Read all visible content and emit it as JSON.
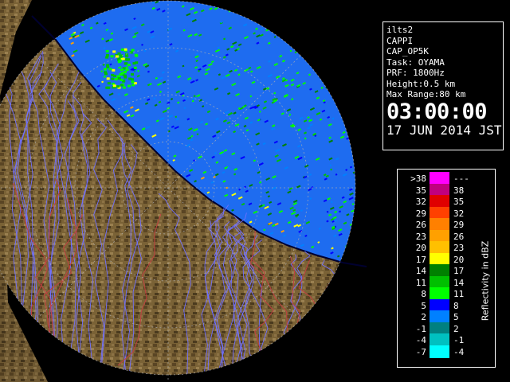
{
  "info": {
    "station": "ilts2",
    "product": "CAPPI",
    "product_code": "CAP_OP5K",
    "task": "Task: OYAMA",
    "prf": "PRF: 1800Hz",
    "height": "Height:0.5 km",
    "max_range": "Max Range:80 km",
    "time": "03:00:00",
    "date": "17 JUN 2014 JST"
  },
  "legend": {
    "unit_label": "Reflectivity in dBZ",
    "bins": [
      {
        "min": ">38",
        "max": "---",
        "color": "#ff00ff"
      },
      {
        "min": "35",
        "max": "38",
        "color": "#c00080"
      },
      {
        "min": "32",
        "max": "35",
        "color": "#e00000"
      },
      {
        "min": "29",
        "max": "32",
        "color": "#ff4000"
      },
      {
        "min": "26",
        "max": "29",
        "color": "#ff8000"
      },
      {
        "min": "23",
        "max": "26",
        "color": "#ffa000"
      },
      {
        "min": "20",
        "max": "23",
        "color": "#ffc000"
      },
      {
        "min": "17",
        "max": "20",
        "color": "#ffff00"
      },
      {
        "min": "14",
        "max": "17",
        "color": "#008000"
      },
      {
        "min": "11",
        "max": "14",
        "color": "#00c000"
      },
      {
        "min": "8",
        "max": "11",
        "color": "#00ff00"
      },
      {
        "min": "5",
        "max": "8",
        "color": "#0000ff"
      },
      {
        "min": "2",
        "max": "5",
        "color": "#0080ff"
      },
      {
        "min": "-1",
        "max": "2",
        "color": "#008080"
      },
      {
        "min": "-4",
        "max": "-1",
        "color": "#00c0c0"
      },
      {
        "min": "-7",
        "max": "-4",
        "color": "#00ffff"
      }
    ]
  },
  "map": {
    "land_color": "#7a6236",
    "land_dark": "#4a3a1e",
    "sea_color": "#1e6cf0",
    "outer_color": "#000000",
    "range_ring_color": "#b0b0b0",
    "river_color": "#7070ff",
    "boundary_color": "#c04040",
    "coast_color": "#000030"
  }
}
